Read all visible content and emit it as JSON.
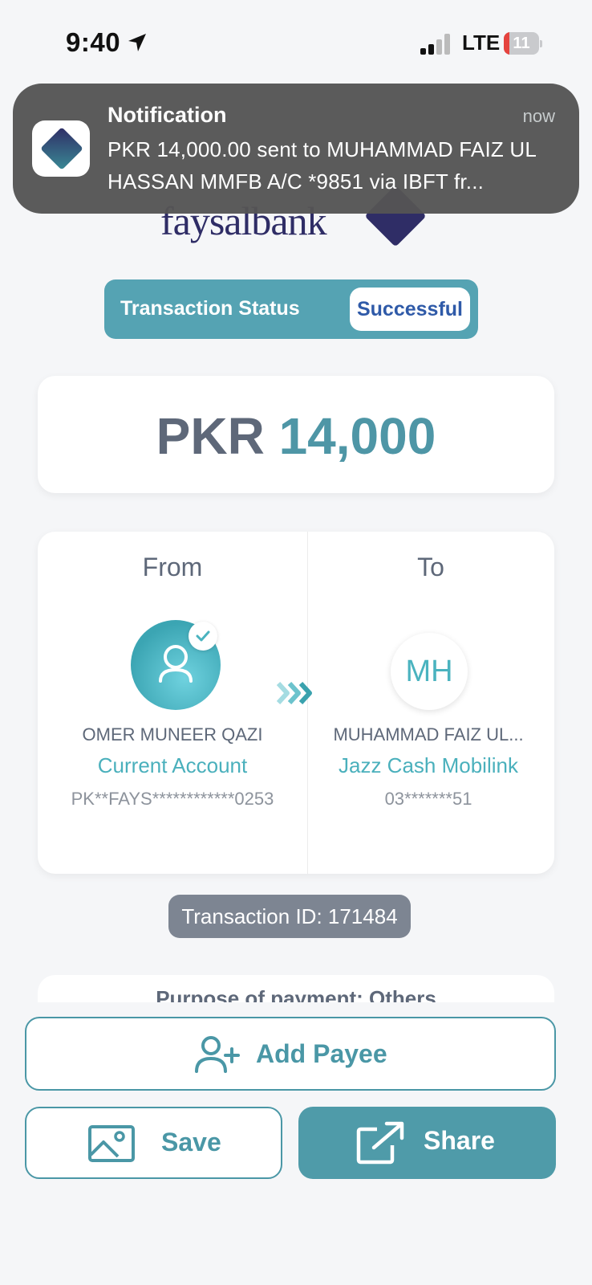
{
  "status_bar": {
    "time": "9:40",
    "network": "LTE",
    "battery": "11"
  },
  "notification": {
    "title": "Notification",
    "time": "now",
    "body": "PKR 14,000.00 sent to MUHAMMAD FAIZ UL HASSAN MMFB A/C *9851 via IBFT fr..."
  },
  "transaction_status": {
    "label": "Transaction Status",
    "value": "Successful"
  },
  "amount": {
    "currency": "PKR",
    "value": "14,000"
  },
  "from": {
    "heading": "From",
    "name": "OMER MUNEER QAZI",
    "account_type": "Current Account",
    "account_number": "PK**FAYS************0253"
  },
  "to": {
    "heading": "To",
    "initials": "MH",
    "name": "MUHAMMAD FAIZ UL...",
    "account_type": "Jazz Cash Mobilink",
    "account_number": "03*******51"
  },
  "transaction_id": "Transaction ID: 171484",
  "purpose": "Purpose of payment: Others",
  "buttons": {
    "add_payee": "Add Payee",
    "save": "Save",
    "share": "Share"
  },
  "colors": {
    "accent": "#4a97a6",
    "status_pill": "#55a3b3",
    "success_text": "#2f5aa8"
  }
}
